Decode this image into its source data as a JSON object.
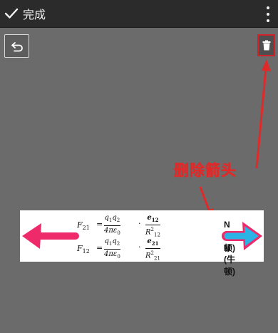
{
  "topbar": {
    "done_label": "完成",
    "done_icon": "checkmark-icon",
    "menu_icon": "more-vert-icon"
  },
  "tools": {
    "undo_icon": "undo-icon",
    "trash_icon": "trash-icon"
  },
  "annotation": {
    "label": "删除箭头",
    "color": "#e02a2a"
  },
  "formula": {
    "eq1": {
      "lhs": "F",
      "lhs_sub": "21",
      "q1": "q",
      "q1_sub": "1",
      "q2": "q",
      "q2_sub": "2",
      "den": "4πε",
      "den_sub": "0",
      "e": "e",
      "e_sub": "12",
      "r": "R",
      "r_sup": "2",
      "r_sub": "12",
      "unit": "N (牛顿)"
    },
    "eq2": {
      "lhs": "F",
      "lhs_sub": "12",
      "q1": "q",
      "q1_sub": "1",
      "q2": "q",
      "q2_sub": "2",
      "den": "4πε",
      "den_sub": "0",
      "e": "e",
      "e_sub": "21",
      "r": "R",
      "r_sup": "2",
      "r_sub": "21",
      "unit": "N (牛顿)"
    }
  },
  "colors": {
    "left_arrow": "#ee2a6b",
    "right_arrow_fill": "#2bb3e6",
    "right_arrow_outline": "#ee2a6b",
    "highlight_box": "#d0222a"
  }
}
